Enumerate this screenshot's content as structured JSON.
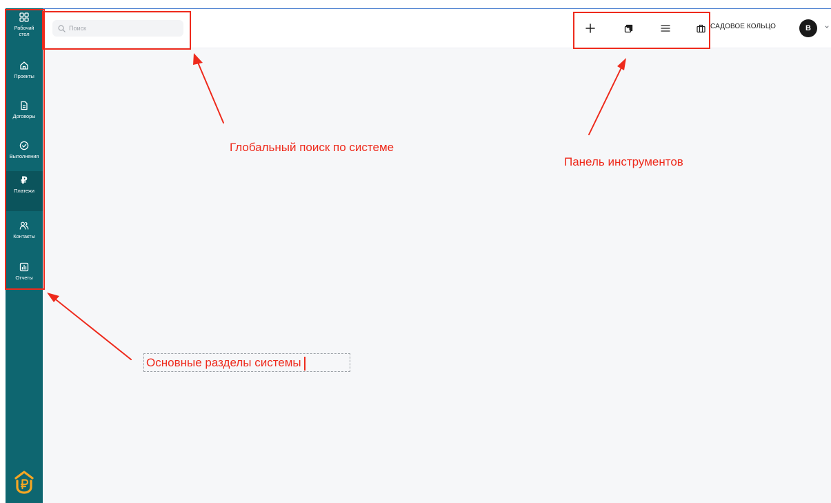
{
  "sidebar": {
    "items": [
      {
        "label": "Рабочий\nстол",
        "icon": "dashboard-grid-icon"
      },
      {
        "label": "Проекты",
        "icon": "home-icon"
      },
      {
        "label": "Договоры",
        "icon": "document-icon"
      },
      {
        "label": "Выполнения",
        "icon": "check-circle-icon"
      },
      {
        "label": "Платежи",
        "icon": "ruble-icon",
        "glyph": "₽",
        "active": true
      },
      {
        "label": "Контакты",
        "icon": "users-icon"
      },
      {
        "label": "Отчеты",
        "icon": "chart-icon"
      }
    ],
    "logo": "ruble-house-logo-icon"
  },
  "header": {
    "search": {
      "placeholder": "Поиск",
      "value": ""
    },
    "tools": [
      {
        "icon": "plus-icon"
      },
      {
        "icon": "copy-icon"
      },
      {
        "icon": "menu-lines-icon"
      },
      {
        "icon": "briefcase-icon"
      }
    ],
    "company": "САДОВОЕ КОЛЬЦО",
    "avatar": {
      "initial": "В"
    }
  },
  "annotations": {
    "search": "Глобальный поиск по системе",
    "toolbar": "Панель инструментов",
    "sections": "Основные разделы системы"
  },
  "colors": {
    "sidebar": "#0e6670",
    "sidebar_active": "#0b545c",
    "annotation": "#ee2a1c",
    "content_bg": "#f6f7f9",
    "logo": "#f5a623"
  }
}
